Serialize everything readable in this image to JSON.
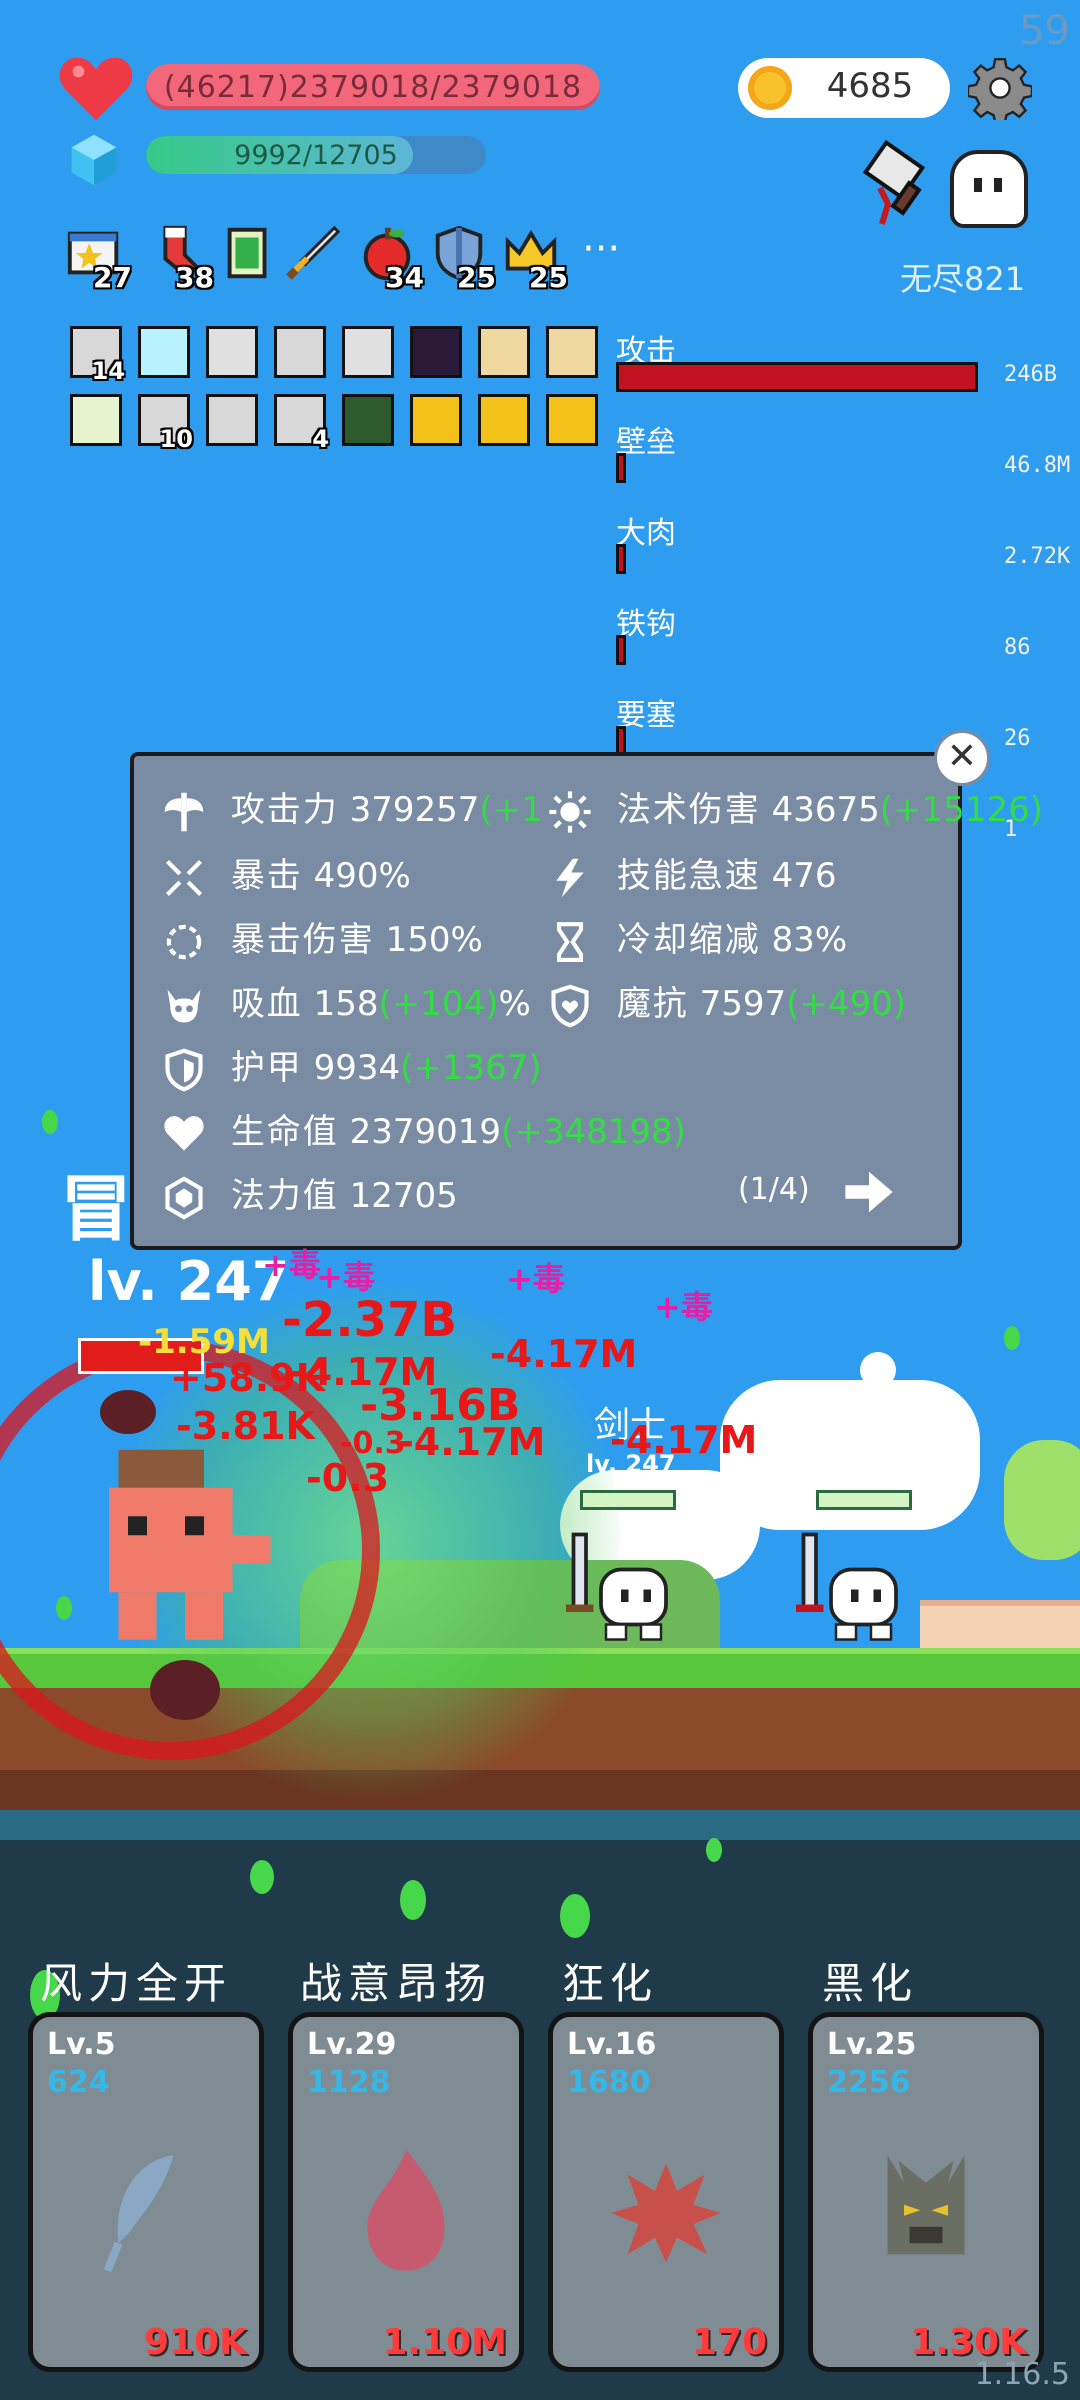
{
  "fps": "59",
  "hp_text": "(46217)2379018/2379018",
  "mp_text": "9992/12705",
  "mp_fraction": 0.786,
  "coins": "4685",
  "endless_label": "无尽821",
  "icons": {
    "heart": "heart-icon",
    "gem": "mana-gem-icon",
    "coin": "coin-icon",
    "gear": "gear-icon"
  },
  "items": [
    {
      "name": "star-book-item",
      "count": "27"
    },
    {
      "name": "sock-item",
      "count": "38"
    },
    {
      "name": "green-card-item",
      "count": ""
    },
    {
      "name": "sword-item",
      "count": ""
    },
    {
      "name": "apple-item",
      "count": "34"
    },
    {
      "name": "shield-item",
      "count": "25"
    },
    {
      "name": "crown-item",
      "count": "25"
    }
  ],
  "more_dots": "···",
  "equip_counts": {
    "r0c0": "14",
    "r1c1": "10",
    "r1c3": "4"
  },
  "ranking": [
    {
      "name": "攻击",
      "value": "246B",
      "fraction": 1.0
    },
    {
      "name": "壁垒",
      "value": "46.8M",
      "fraction": 0.0
    },
    {
      "name": "大肉",
      "value": "2.72K",
      "fraction": 0.0
    },
    {
      "name": "铁钩",
      "value": "86",
      "fraction": 0.0
    },
    {
      "name": "要塞",
      "value": "26",
      "fraction": 0.0
    },
    {
      "name": "",
      "value": "1",
      "fraction": 0.0
    }
  ],
  "stats": {
    "attack": {
      "label": "攻击力",
      "value": "379257",
      "bonus": "(+1",
      "tail": ""
    },
    "spell": {
      "label": "法术伤害",
      "value": "43675",
      "bonus": "(+15126)"
    },
    "crit": {
      "label": "暴击",
      "value": "490%"
    },
    "haste": {
      "label": "技能急速",
      "value": "476"
    },
    "critdmg": {
      "label": "暴击伤害",
      "value": "150%"
    },
    "cdr": {
      "label": "冷却缩减",
      "value": "83%"
    },
    "lifesteal": {
      "label": "吸血",
      "value": "158",
      "bonus": "(+104)",
      "suffix": "%"
    },
    "mres": {
      "label": "魔抗",
      "value": "7597",
      "bonus": "(+490)"
    },
    "armor": {
      "label": "护甲",
      "value": "9934",
      "bonus": "(+1367)"
    },
    "hp": {
      "label": "生命值",
      "value": "2379019",
      "bonus": "(+348198)"
    },
    "mp": {
      "label": "法力值",
      "value": "12705"
    }
  },
  "page_indicator": "(1/4)",
  "close_symbol": "✕",
  "adventure_label": "冒",
  "player_level": "lv. 247",
  "enemies": [
    {
      "name": "剑士",
      "level": "lv. 247"
    },
    {
      "name": "剑士",
      "level": "247"
    }
  ],
  "damage_texts": [
    "-1.59M",
    "-2.37B",
    "+58.9K",
    "-4.17M",
    "-4.17M",
    "-3.81K",
    "-4.17M",
    "-3.16B",
    "-4.17M",
    "-0.3",
    "-0.3"
  ],
  "heal_texts": [
    "+毒",
    "+毒",
    "+毒",
    "+毒"
  ],
  "skills": [
    {
      "name": "风力全开",
      "level": "Lv.5",
      "cost": "624",
      "value": "910K",
      "emblem": "feather-icon"
    },
    {
      "name": "战意昂扬",
      "level": "Lv.29",
      "cost": "1128",
      "value": "1.10M",
      "emblem": "flame-icon"
    },
    {
      "name": "狂化",
      "level": "Lv.16",
      "cost": "1680",
      "value": "170",
      "emblem": "burst-icon"
    },
    {
      "name": "黑化",
      "level": "Lv.25",
      "cost": "2256",
      "value": "1.30K",
      "emblem": "tree-monster-icon"
    }
  ],
  "version": "1.16.5"
}
